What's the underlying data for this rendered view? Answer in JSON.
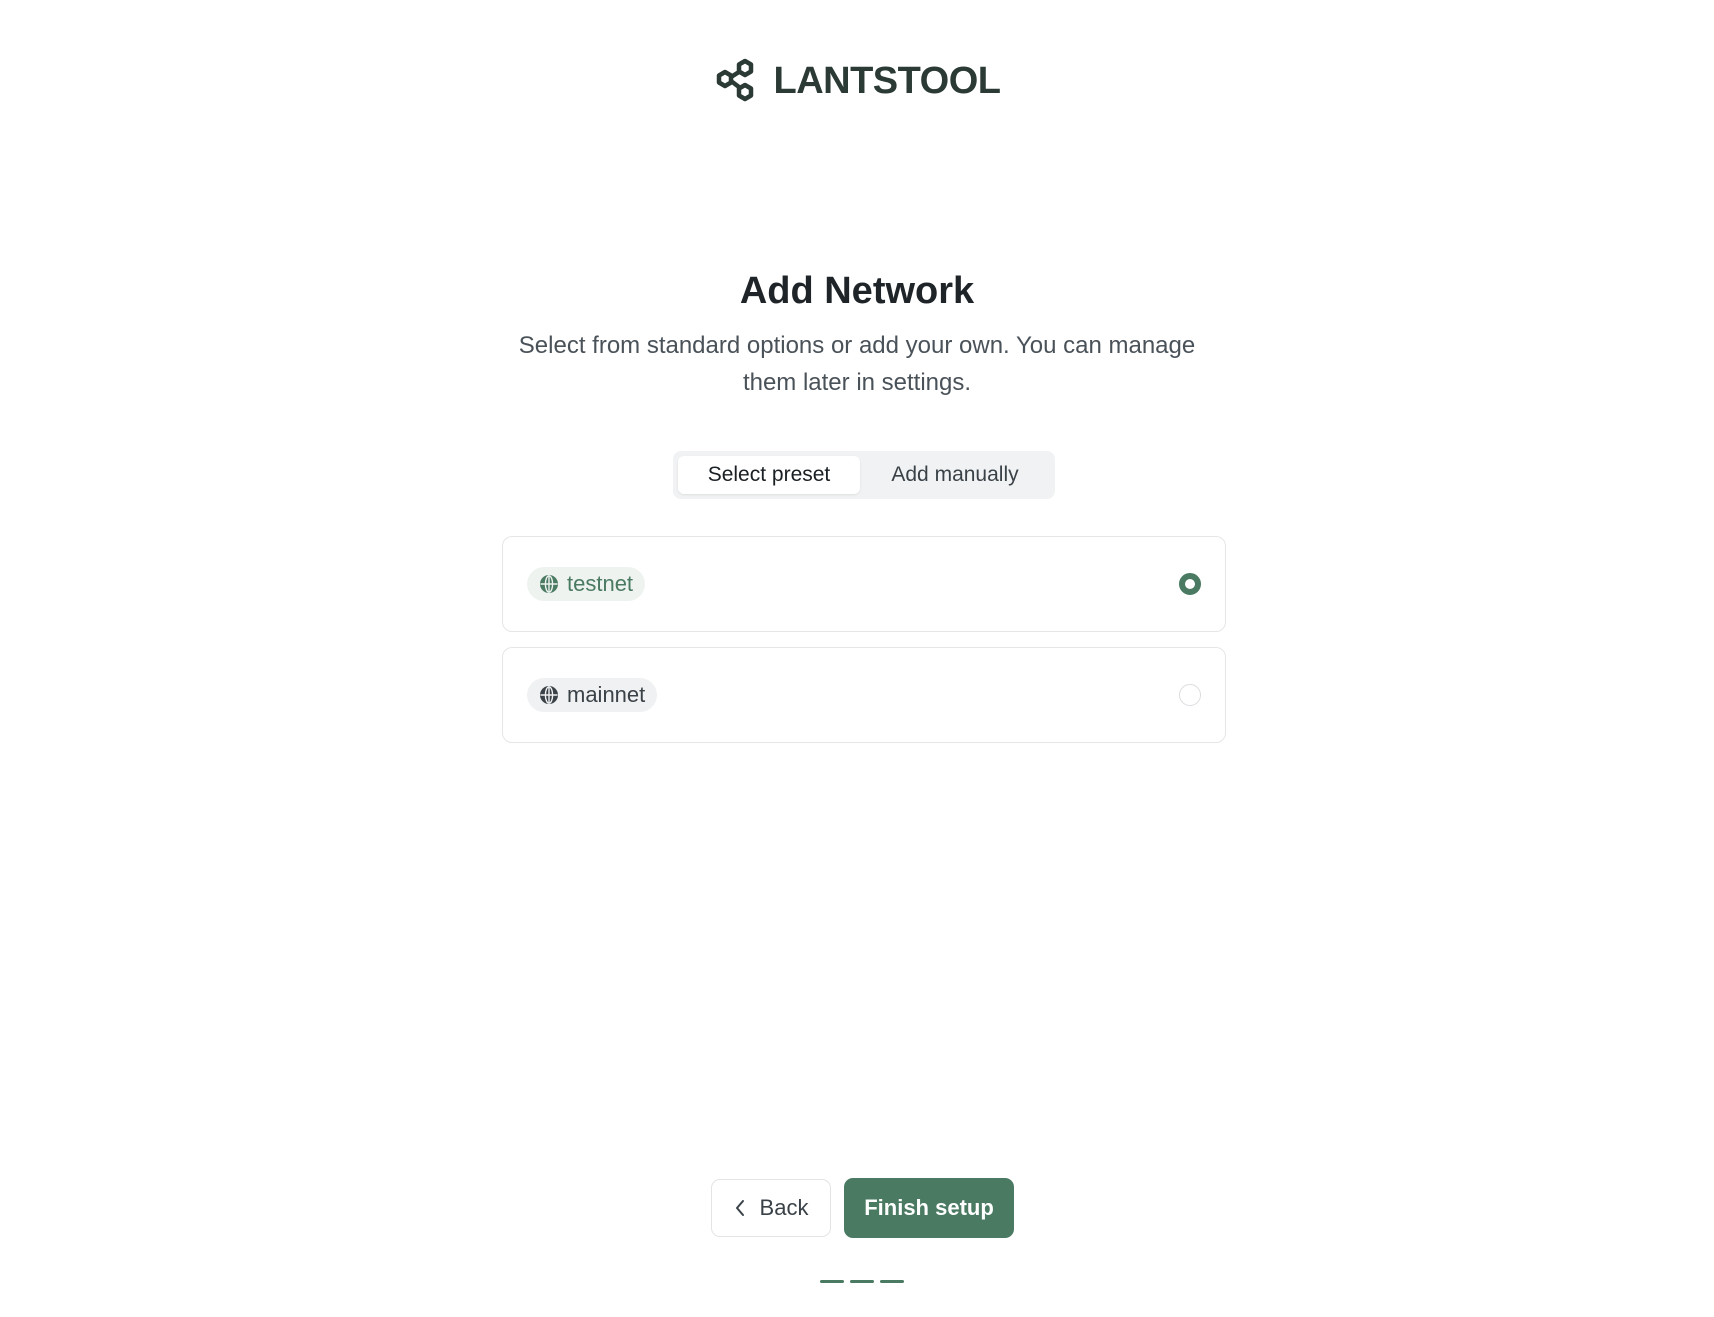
{
  "brand": {
    "name": "LANTSTOOL",
    "logo_icon": "hexagon-cluster-icon"
  },
  "header": {
    "title": "Add Network",
    "subtitle": "Select from standard options or add your own. You can manage them later in settings."
  },
  "tabs": [
    {
      "label": "Select preset",
      "active": true
    },
    {
      "label": "Add manually",
      "active": false
    }
  ],
  "networks": [
    {
      "label": "testnet",
      "icon": "globe-icon",
      "selected": true
    },
    {
      "label": "mainnet",
      "icon": "globe-icon",
      "selected": false
    }
  ],
  "footer": {
    "back_label": "Back",
    "back_icon": "chevron-left-icon",
    "finish_label": "Finish setup",
    "steps_total": 3
  },
  "colors": {
    "accent": "#4a7a62",
    "logo": "#2b3a34",
    "heading": "#1f2428",
    "muted": "#4a5259"
  }
}
